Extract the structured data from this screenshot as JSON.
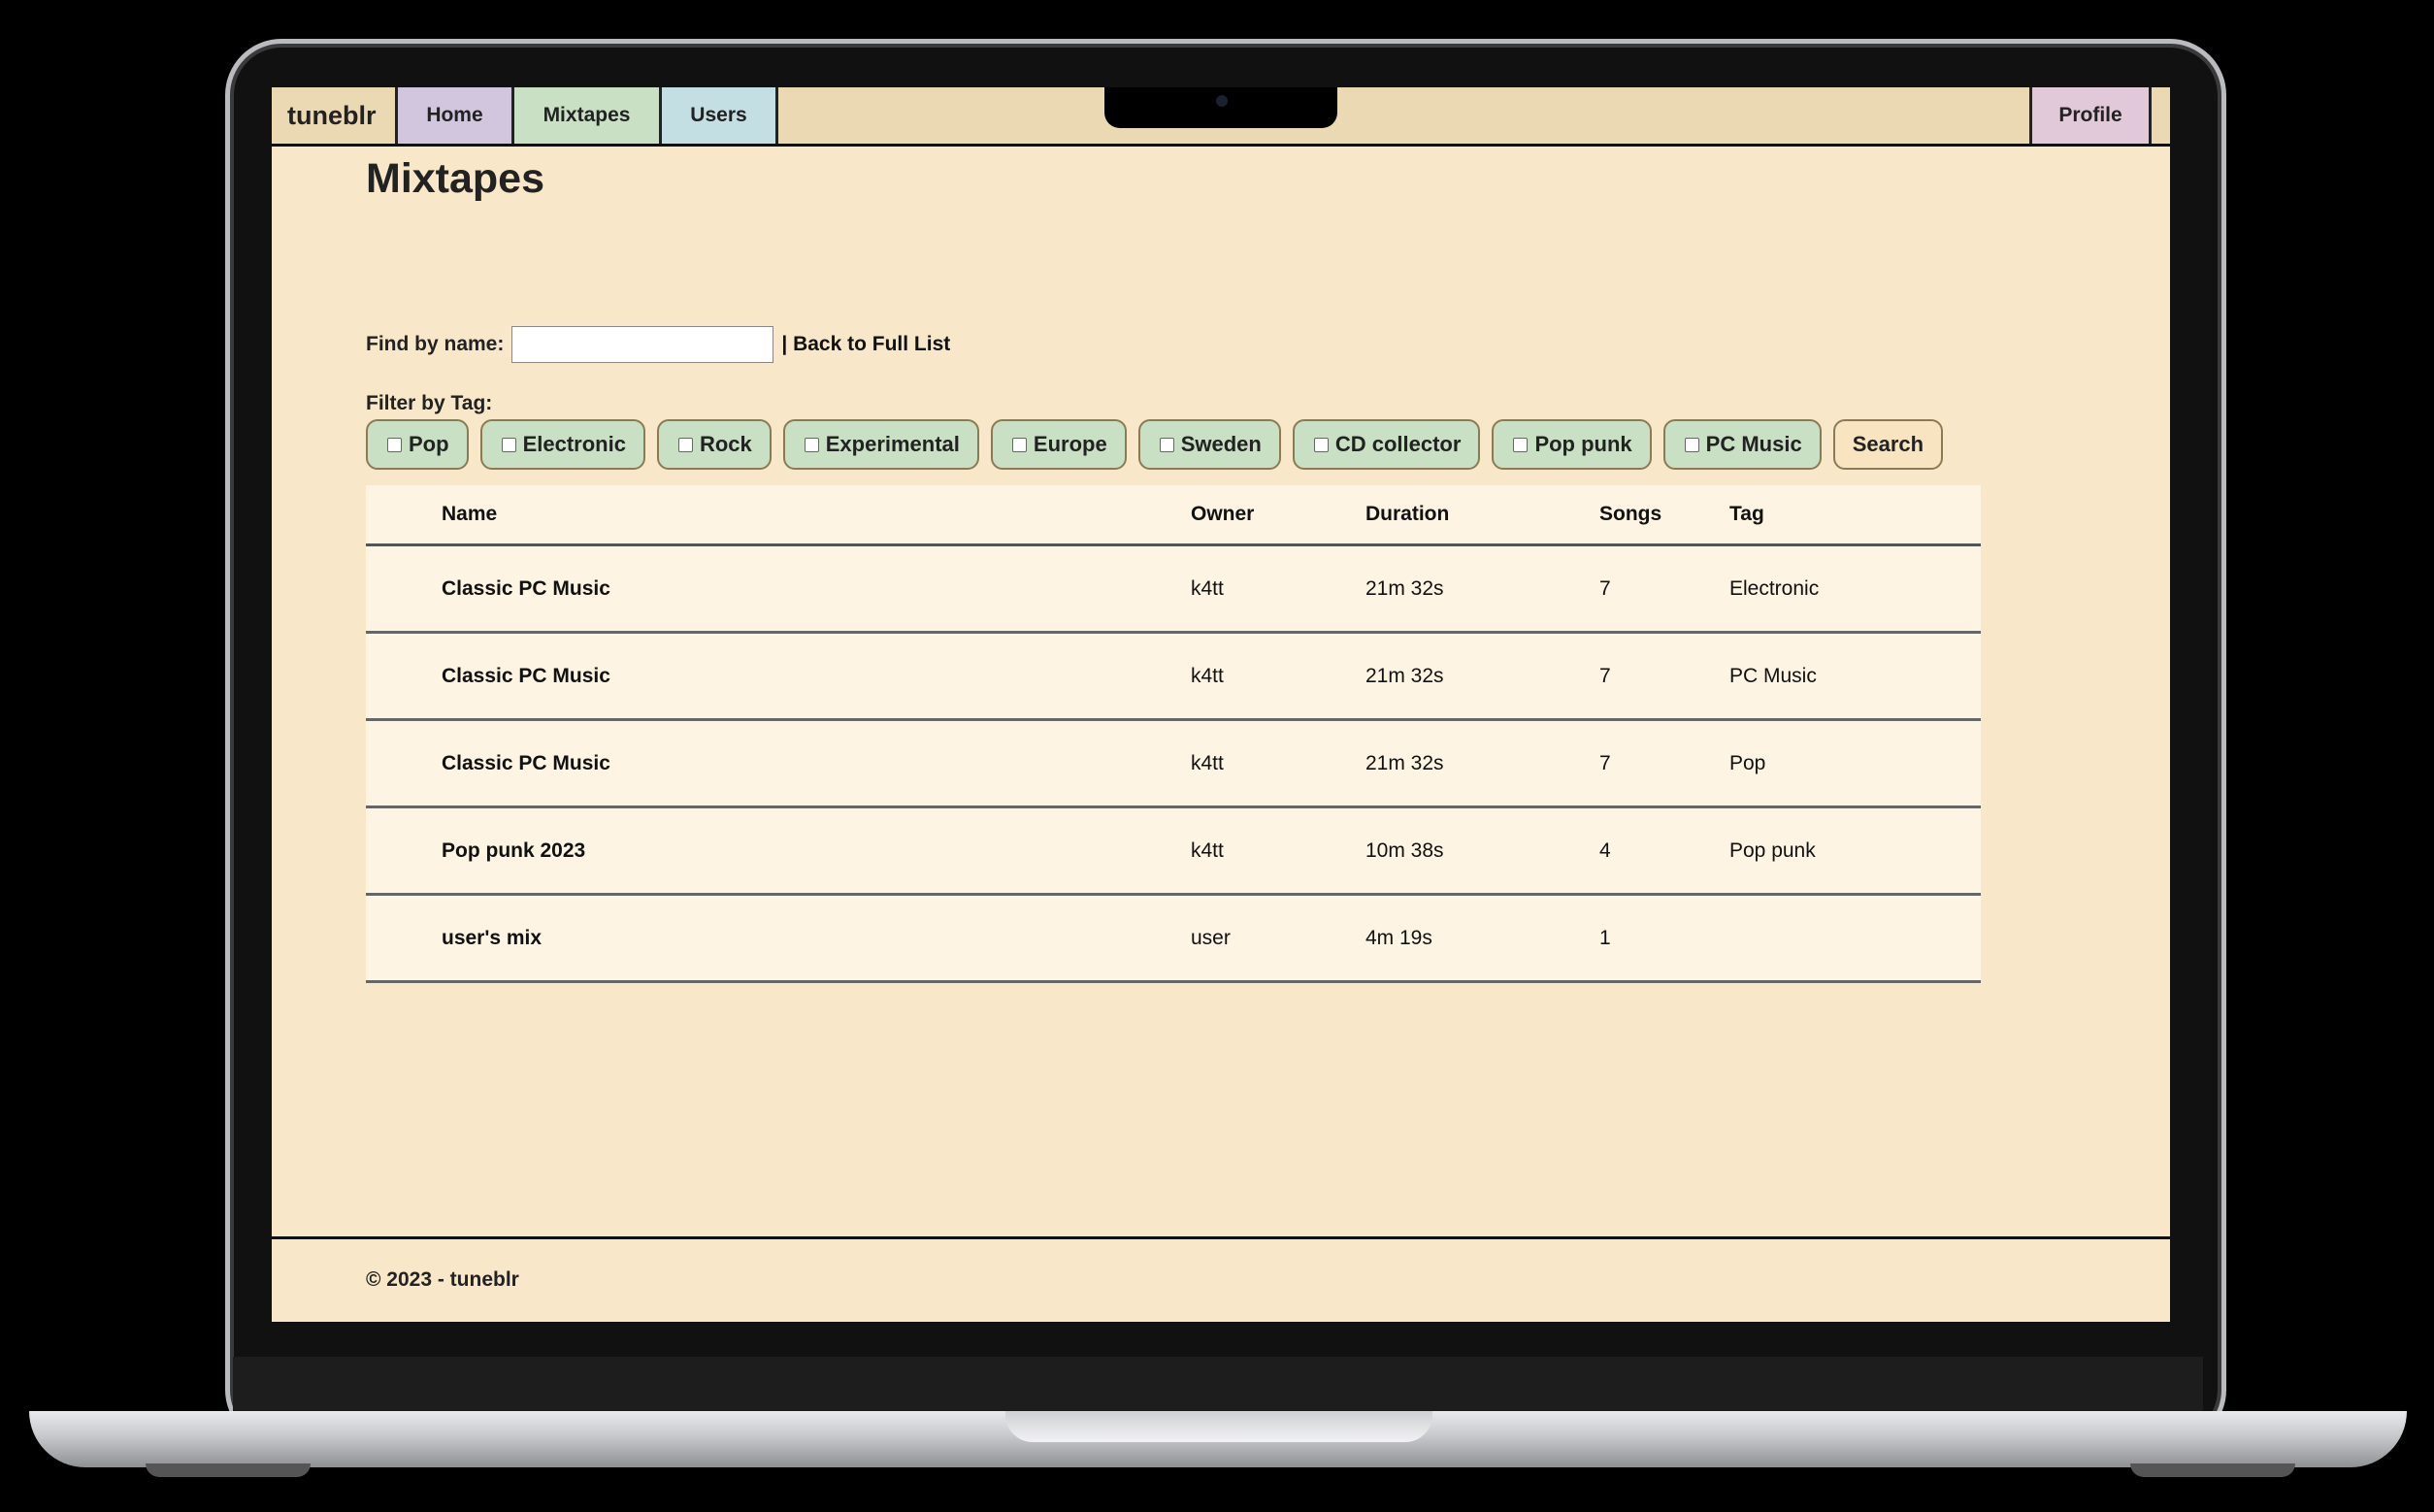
{
  "nav": {
    "brand": "tuneblr",
    "home": "Home",
    "mixtapes": "Mixtapes",
    "users": "Users",
    "profile": "Profile"
  },
  "page": {
    "title": "Mixtapes",
    "find_label": "Find by name:",
    "find_value": "",
    "back_link": "| Back to Full List",
    "filter_label": "Filter by Tag:"
  },
  "tags": [
    "Pop",
    "Electronic",
    "Rock",
    "Experimental",
    "Europe",
    "Sweden",
    "CD collector",
    "Pop punk",
    "PC Music"
  ],
  "search_label": "Search",
  "table": {
    "headers": [
      "Name",
      "Owner",
      "Duration",
      "Songs",
      "Tag"
    ],
    "rows": [
      [
        "Classic PC Music",
        "k4tt",
        "21m 32s",
        "7",
        "Electronic"
      ],
      [
        "Classic PC Music",
        "k4tt",
        "21m 32s",
        "7",
        "PC Music"
      ],
      [
        "Classic PC Music",
        "k4tt",
        "21m 32s",
        "7",
        "Pop"
      ],
      [
        "Pop punk 2023",
        "k4tt",
        "10m 38s",
        "4",
        "Pop punk"
      ],
      [
        "user's mix",
        "user",
        "4m 19s",
        "1",
        ""
      ]
    ]
  },
  "footer": "© 2023 - tuneblr",
  "colors": {
    "page_bg": "#f8e8c9",
    "nav_bg": "#ead9b2",
    "home_tab": "#d2c6df",
    "mixtapes_tab": "#c9e0c5",
    "users_tab": "#c4dfe4",
    "profile_tab": "#e2c9d9",
    "tag_bg": "#c9e0c5",
    "table_bg": "#fdf4e3"
  }
}
